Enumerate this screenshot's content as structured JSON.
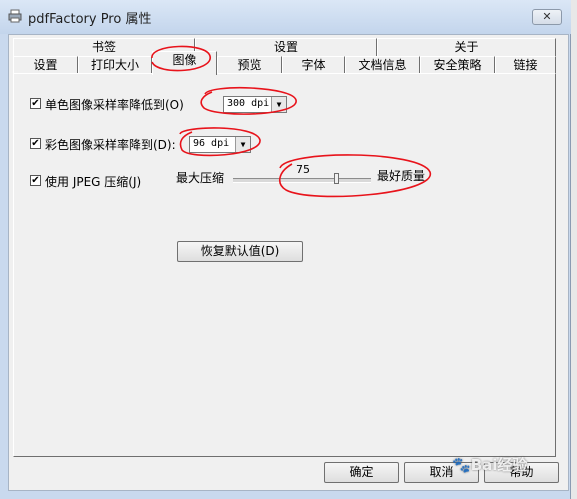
{
  "window": {
    "title": "pdfFactory Pro 属性",
    "close_icon": "close-icon",
    "app_icon": "printer-icon"
  },
  "tabs": {
    "row1": [
      "书签",
      "设置",
      "关于"
    ],
    "row2": [
      "设置",
      "打印大小",
      "图像",
      "预览",
      "字体",
      "文档信息",
      "安全策略",
      "链接"
    ],
    "active": "图像"
  },
  "image_settings": {
    "mono": {
      "checked": true,
      "label": "单色图像采样率降低到(O)",
      "value": "300 dpi"
    },
    "color": {
      "checked": true,
      "label": "彩色图像采样率降到(D):",
      "value": "96 dpi"
    },
    "jpeg": {
      "checked": true,
      "label": "使用 JPEG 压缩(J)",
      "min_label": "最大压缩",
      "max_label": "最好质量",
      "quality_value": "75",
      "quality_fraction": 0.75
    },
    "restore_label": "恢复默认值(D)"
  },
  "footer": {
    "ok_label": "确定",
    "cancel_label": "取消",
    "help_label": "帮助"
  },
  "watermark": "Bai经验",
  "annotation_color": "#e8131b"
}
